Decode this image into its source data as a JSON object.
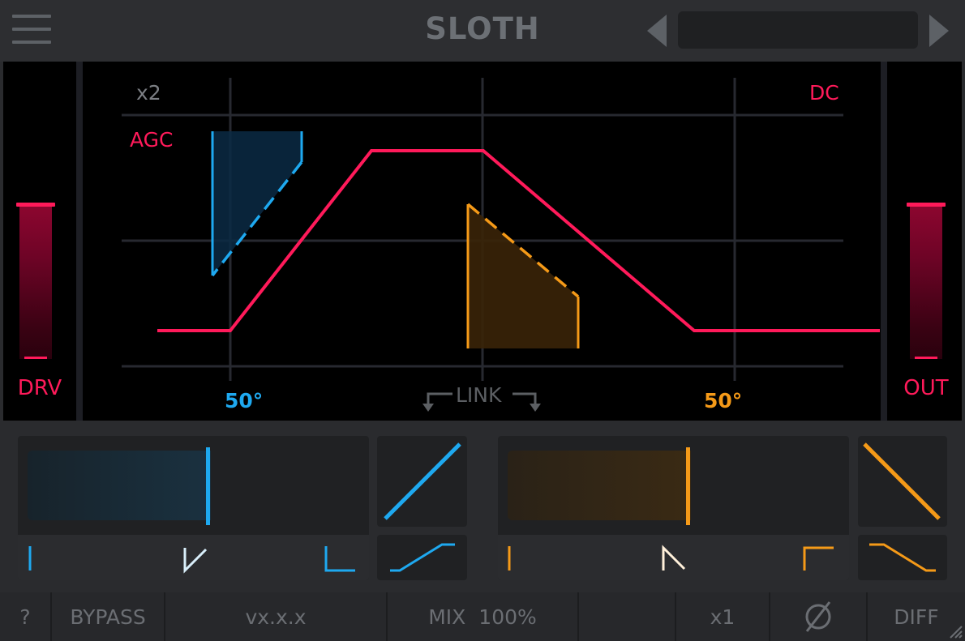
{
  "header": {
    "title": "SLOTH",
    "preset_name": ""
  },
  "display": {
    "left_meter_label": "DRV",
    "right_meter_label": "OUT",
    "label_oversample": "x2",
    "label_agc": "AGC",
    "label_dc": "DC",
    "left_angle": "50°",
    "right_angle": "50°",
    "link_label": "LINK"
  },
  "footer": {
    "help": "?",
    "bypass": "BYPASS",
    "version": "vx.x.x",
    "mix_label": "MIX",
    "mix_value": "100%",
    "multiplier": "x1",
    "phase_icon": "phase-invert-icon",
    "diff": "DIFF"
  },
  "colors": {
    "accent_red": "#ff1a5a",
    "accent_blue": "#1ea9f0",
    "accent_orange": "#f59a18"
  }
}
